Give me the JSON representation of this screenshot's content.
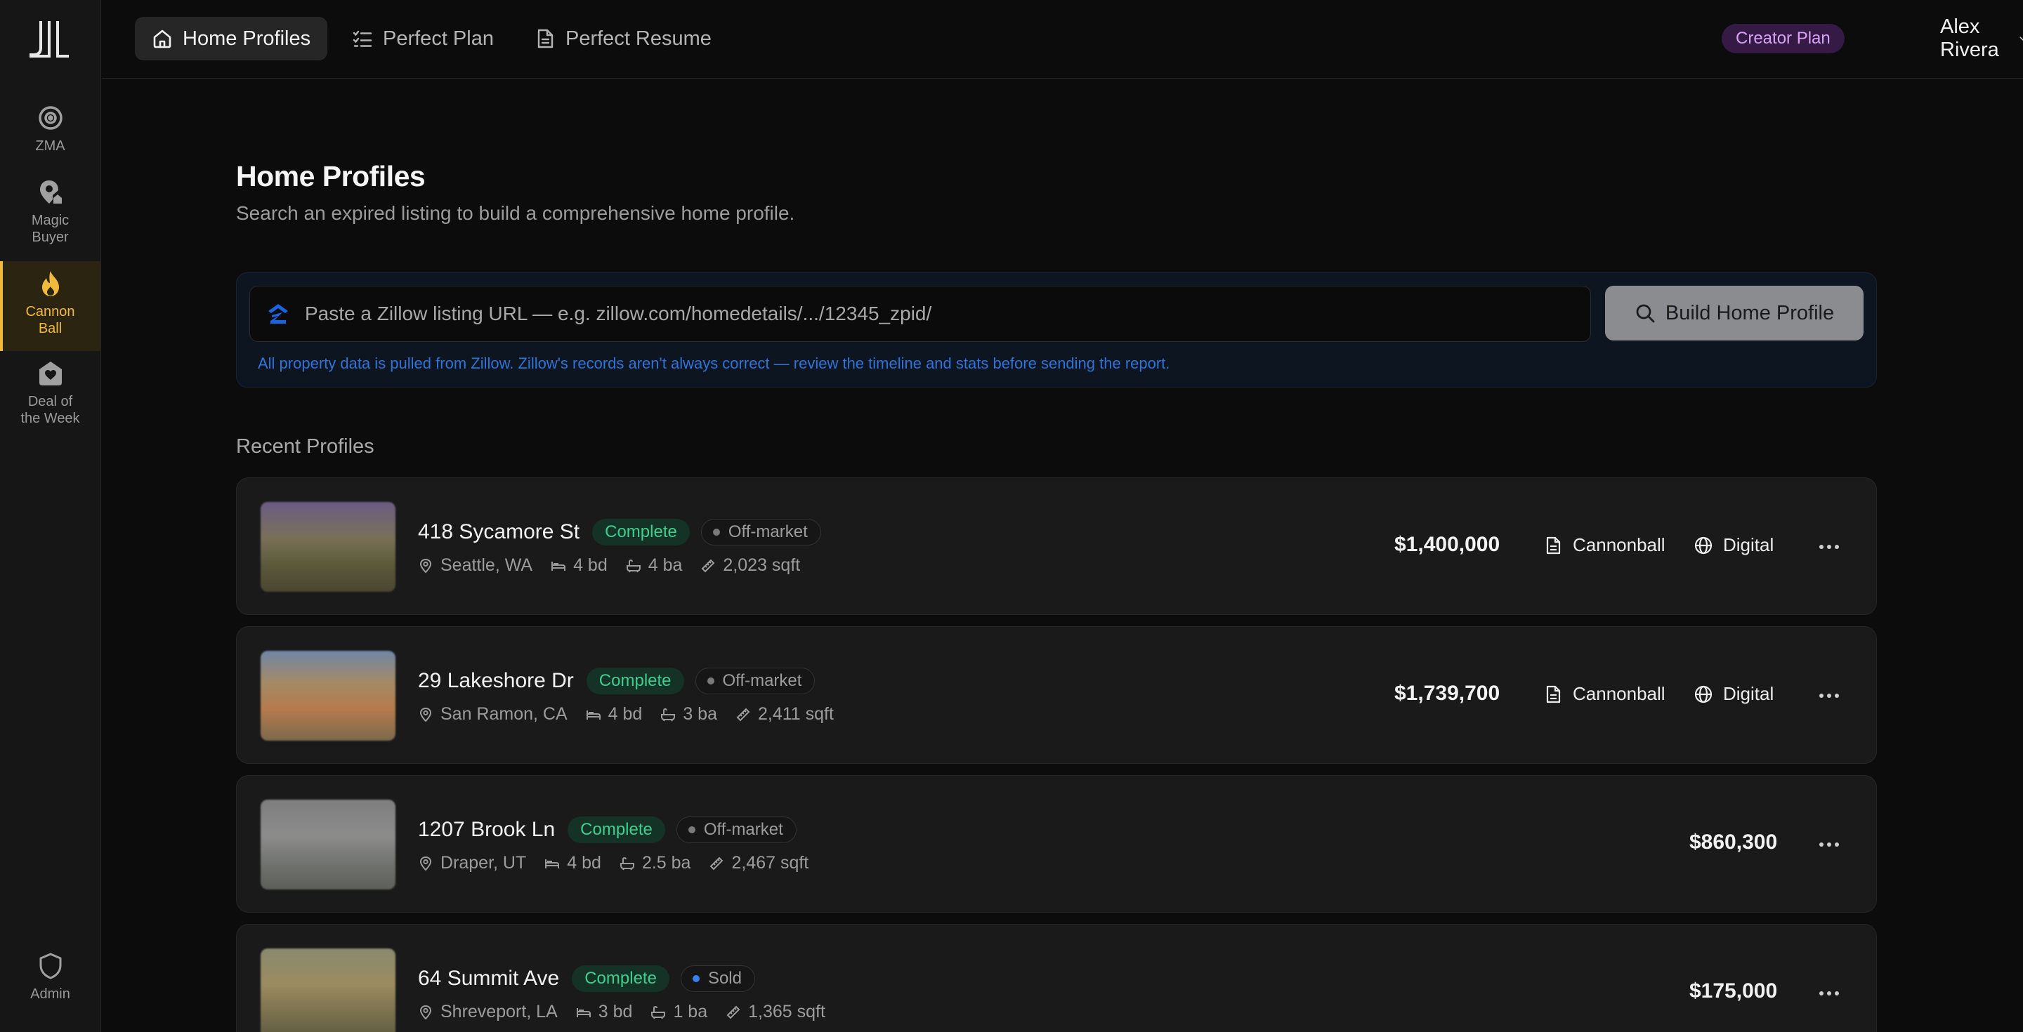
{
  "nav": {
    "zma": "ZMA",
    "magic_buyer_1": "Magic",
    "magic_buyer_2": "Buyer",
    "cannon_1": "Cannon",
    "cannon_2": "Ball",
    "deal_1": "Deal of",
    "deal_2": "the Week",
    "admin": "Admin",
    "active_color": "#f1b93c"
  },
  "topbar": {
    "tabs": [
      {
        "label": "Home Profiles",
        "icon": "home-icon",
        "active": true
      },
      {
        "label": "Perfect Plan",
        "icon": "checklist-icon",
        "active": false
      },
      {
        "label": "Perfect Resume",
        "icon": "document-icon",
        "active": false
      }
    ],
    "plan_badge": "Creator Plan",
    "user_name": "Alex Rivera"
  },
  "page": {
    "title": "Home Profiles",
    "subtitle": "Search an expired listing to build a comprehensive home profile."
  },
  "search": {
    "placeholder": "Paste a Zillow listing URL — e.g. zillow.com/homedetails/.../12345_zpid/",
    "value": "",
    "button_label": "Build Home Profile",
    "note": "All property data is pulled from Zillow. Zillow's records aren't always correct — review the timeline and stats before sending the report."
  },
  "recent": {
    "label": "Recent Profiles",
    "items": [
      {
        "address": "418 Sycamore St",
        "status": "Complete",
        "market": "Off-market",
        "location": "Seattle, WA",
        "beds": "4 bd",
        "baths": "4 ba",
        "sqft": "2,023 sqft",
        "price": "$1,400,000",
        "cannonball": "Cannonball",
        "digital": "Digital"
      },
      {
        "address": "29 Lakeshore Dr",
        "status": "Complete",
        "market": "Off-market",
        "location": "San Ramon, CA",
        "beds": "4 bd",
        "baths": "3 ba",
        "sqft": "2,411 sqft",
        "price": "$1,739,700",
        "cannonball": "Cannonball",
        "digital": "Digital"
      },
      {
        "address": "1207 Brook Ln",
        "status": "Complete",
        "market": "Off-market",
        "location": "Draper, UT",
        "beds": "4 bd",
        "baths": "2.5 ba",
        "sqft": "2,467 sqft",
        "price": "$860,300"
      },
      {
        "address": "64 Summit Ave",
        "status": "Complete",
        "market": "Sold",
        "location": "Shreveport, LA",
        "beds": "3 bd",
        "baths": "1 ba",
        "sqft": "1,365 sqft",
        "price": "$175,000"
      }
    ]
  }
}
